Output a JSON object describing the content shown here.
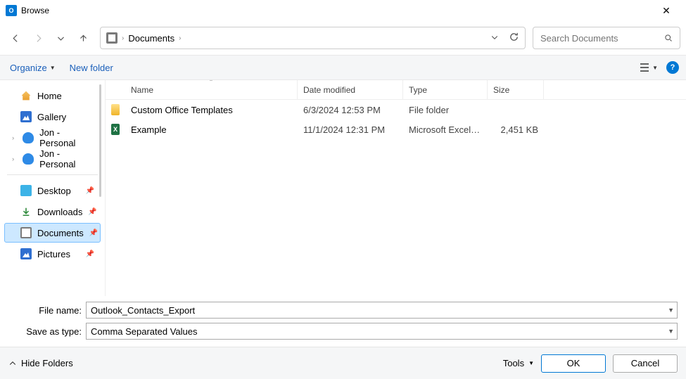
{
  "window": {
    "title": "Browse",
    "app_badge": "O"
  },
  "breadcrumb": {
    "path": "Documents"
  },
  "search": {
    "placeholder": "Search Documents"
  },
  "toolbar": {
    "organize": "Organize",
    "new_folder": "New folder"
  },
  "sidebar": {
    "home": "Home",
    "gallery": "Gallery",
    "onedrive1": "Jon - Personal",
    "onedrive2": "Jon - Personal",
    "desktop": "Desktop",
    "downloads": "Downloads",
    "documents": "Documents",
    "pictures": "Pictures"
  },
  "columns": {
    "name": "Name",
    "date": "Date modified",
    "type": "Type",
    "size": "Size"
  },
  "files": [
    {
      "name": "Custom Office Templates",
      "date": "6/3/2024 12:53 PM",
      "type": "File folder",
      "size": "",
      "icon": "folder"
    },
    {
      "name": "Example",
      "date": "11/1/2024 12:31 PM",
      "type": "Microsoft Excel C...",
      "size": "2,451 KB",
      "icon": "excel"
    }
  ],
  "fields": {
    "filename_label": "File name:",
    "filename_value": "Outlook_Contacts_Export",
    "saveas_label": "Save as type:",
    "saveas_value": "Comma Separated Values"
  },
  "footer": {
    "hide_folders": "Hide Folders",
    "tools": "Tools",
    "ok": "OK",
    "cancel": "Cancel"
  }
}
